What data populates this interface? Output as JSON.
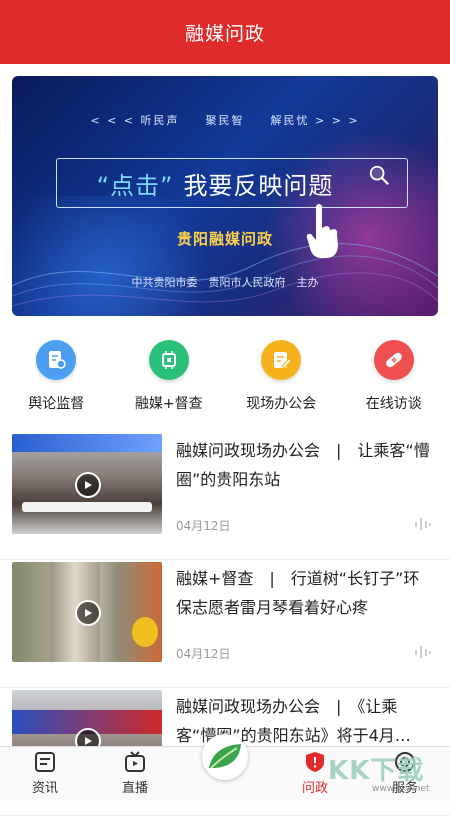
{
  "header": {
    "title": "融媒问政"
  },
  "banner": {
    "top_line": "< < < 听民声　　聚民智　　解民忧 > > >",
    "cta_quote": "“点击”",
    "cta_text": "我要反映问题",
    "logo_text": "贵阳融媒问政",
    "sponsor": "中共贵阳市委　贵阳市人民政府　主办"
  },
  "quick_links": [
    {
      "label": "舆论监督",
      "color": "#4a9ff0",
      "icon": "document-eye-icon"
    },
    {
      "label": "融媒+督查",
      "color": "#2bc07a",
      "icon": "chip-icon"
    },
    {
      "label": "现场办公会",
      "color": "#f5b21c",
      "icon": "edit-note-icon"
    },
    {
      "label": "在线访谈",
      "color": "#ef4f4f",
      "icon": "bandage-icon"
    }
  ],
  "news": [
    {
      "title": "融媒问政现场办公会　|　让乘客“懵圈”的贵阳东站",
      "date": "04月12日"
    },
    {
      "title": "融媒+督查　|　行道树“长钉子”环保志愿者雷月琴看着好心疼",
      "date": "04月12日"
    },
    {
      "title": "融媒问政现场办公会　|　《让乘客“懵圈”的贵阳东站》将于4月…",
      "date": ""
    }
  ],
  "tabbar": {
    "tabs": [
      {
        "label": "资讯"
      },
      {
        "label": "直播"
      },
      {
        "label": ""
      },
      {
        "label": "问政"
      },
      {
        "label": "服务"
      }
    ],
    "active": "问政"
  },
  "watermark": {
    "text": "KK下载",
    "url": "www.kkx.net"
  }
}
